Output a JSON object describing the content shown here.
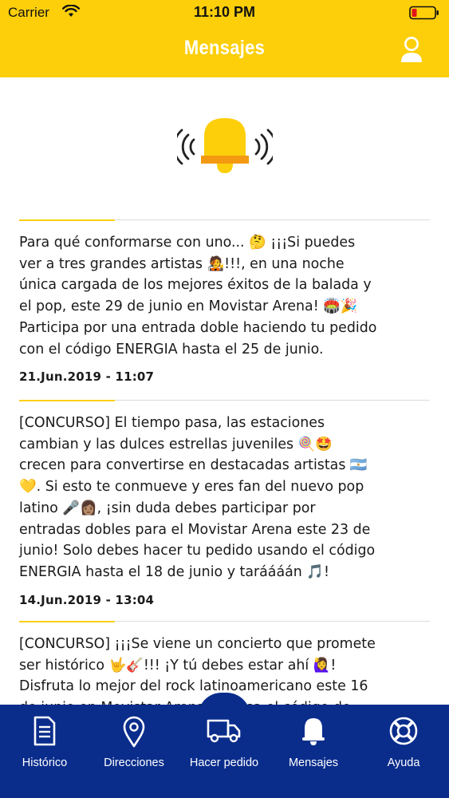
{
  "status_bar": {
    "carrier": "Carrier",
    "time": "11:10 PM"
  },
  "header": {
    "title": "Mensajes",
    "background_color": "#fccf0a",
    "profile_icon": "user-icon"
  },
  "banner": {
    "icon": "bell-ringing-icon",
    "icon_color": "#fccf0a"
  },
  "messages": [
    {
      "text": "Para qué conformarse con uno... 🤔 ¡¡¡Si puedes\nver a tres grandes artistas 🧑‍🎤!!!, en una noche\núnica cargada de los mejores éxitos de la balada y\nel pop, este 29 de junio en Movistar Arena! 🏟️🎉\nParticipa por una entrada doble haciendo tu pedido\ncon el código ENERGIA hasta el 25 de junio.",
      "date": "21.Jun.2019 - 11:07"
    },
    {
      "text": "[CONCURSO] El tiempo pasa, las estaciones\ncambian y las dulces estrellas juveniles 🍭🤩\ncrecen para convertirse en destacadas artistas 🇦🇷\n💛. Si esto te conmueve y eres fan del nuevo pop\nlatino 🎤👩🏽, ¡sin duda debes participar por\nentradas dobles para el Movistar Arena este 23 de\njunio! Solo debes hacer tu pedido usando el código\nENERGIA hasta el 18 de junio y taráááán 🎵!",
      "date": "14.Jun.2019 - 13:04"
    },
    {
      "text": "[CONCURSO] ¡¡¡Se viene un concierto que promete\nser histórico 🤟🎸!!! ¡Y tú debes estar ahí 🙋‍♀️!\nDisfruta lo mejor del rock latinoamericano este 16\nde junio en Movistar Arena 🏟️. Usa el código de",
      "date": ""
    }
  ],
  "tabbar": {
    "background_color": "#0a2d8c",
    "tabs": [
      {
        "label": "Histórico",
        "icon": "document-icon"
      },
      {
        "label": "Direcciones",
        "icon": "location-pin-icon"
      },
      {
        "label": "Hacer pedido",
        "icon": "truck-icon"
      },
      {
        "label": "Mensajes",
        "icon": "bell-icon",
        "active": true
      },
      {
        "label": "Ayuda",
        "icon": "lifebuoy-icon"
      }
    ]
  }
}
